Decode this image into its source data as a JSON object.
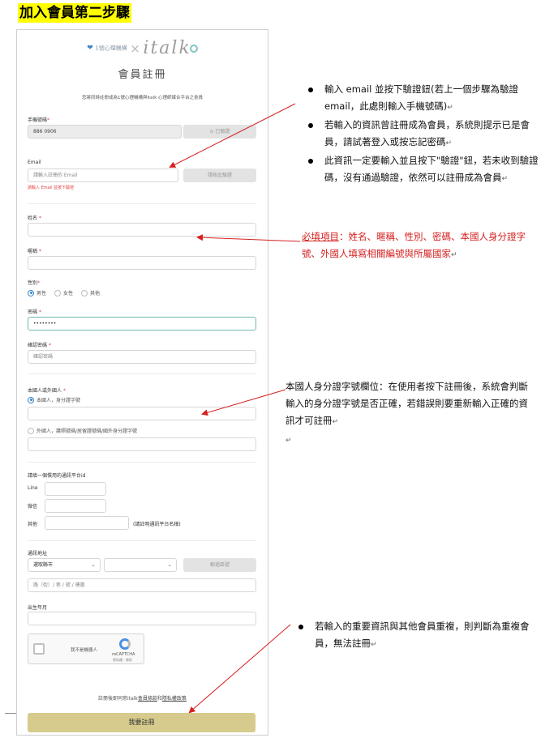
{
  "step_title": "加入會員第二步驟",
  "logo": {
    "prefix": "1號心理機構",
    "x": "×",
    "brand": "italk"
  },
  "form": {
    "title": "會員註冊",
    "description": "您將同時註冊成為1號心理機構與italk 心理師媒合平台之會員",
    "phone_label": "手機號碼",
    "phone_value": "886 0906",
    "phone_verified": "已驗證",
    "email_label": "Email",
    "email_placeholder": "請輸入註冊的 Email",
    "email_button": "請按此驗證",
    "email_error": "請輸入 Email 並按下驗證",
    "name_label": "姓名",
    "nickname_label": "暱稱",
    "gender_label": "性別",
    "gender_options": [
      "男性",
      "女性",
      "其他"
    ],
    "password_label": "密碼",
    "password_value": "••••••••",
    "confirm_label": "確認密碼",
    "confirm_placeholder": "確認密碼",
    "nationality_label": "本國人或外國人",
    "national_option": "本國人，身分證字號",
    "foreign_option": "外國人，護照號碼/居留證號碼/國外身分證字號",
    "platform_label": "請填一個慣用的通訊平台id",
    "line_label": "Line",
    "wechat_label": "微信",
    "other_label": "其他",
    "other_hint": "(請註明通訊平台名稱)",
    "address_label": "通訊地址",
    "city_placeholder": "選取縣市",
    "zip_button": "郵遞區號",
    "street_placeholder": "路（街）/ 巷 / 號 / 樓層",
    "birth_label": "出生年月",
    "recaptcha_label": "我不是機器人",
    "recaptcha_name": "reCAPTCHA",
    "recaptcha_links": "隱私權 - 條款",
    "terms_prefix": "註冊後即同意italk",
    "terms_link1": "會員條款",
    "terms_and": "和",
    "terms_link2": "隱私權政策",
    "submit_label": "我要註冊"
  },
  "notes": {
    "email_notes": [
      "輸入 email 並按下驗證鈕(若上一個步驟為驗證 email，此處則輸入手機號碼)",
      "若輸入的資訊曾註冊成為會員，系統則提示已是會員，請試著登入或按忘記密碼",
      "此資訊一定要輸入並且按下\"驗證\"鈕，若未收到驗證碼，沒有通過驗證，依然可以註冊成為會員"
    ],
    "required_title": "必填項目",
    "required_text": "：姓名、暱稱、性別、密碼、本國人身分證字號、外國人填寫相關編號與所屬國家",
    "id_note": "本國人身分證字號欄位：在使用者按下註冊後，系統會判斷輸入的身分證字號是否正確，若錯誤則要重新輸入正確的資訊才可註冊",
    "duplicate_note": "若輸入的重要資訊與其他會員重複，則判斷為重複會員，無法註冊",
    "return_mark": "↵"
  },
  "colors": {
    "highlight": "#ffff00",
    "arrow": "#d62020",
    "submit": "#d6cb8c",
    "accent": "#6fb9b3"
  }
}
